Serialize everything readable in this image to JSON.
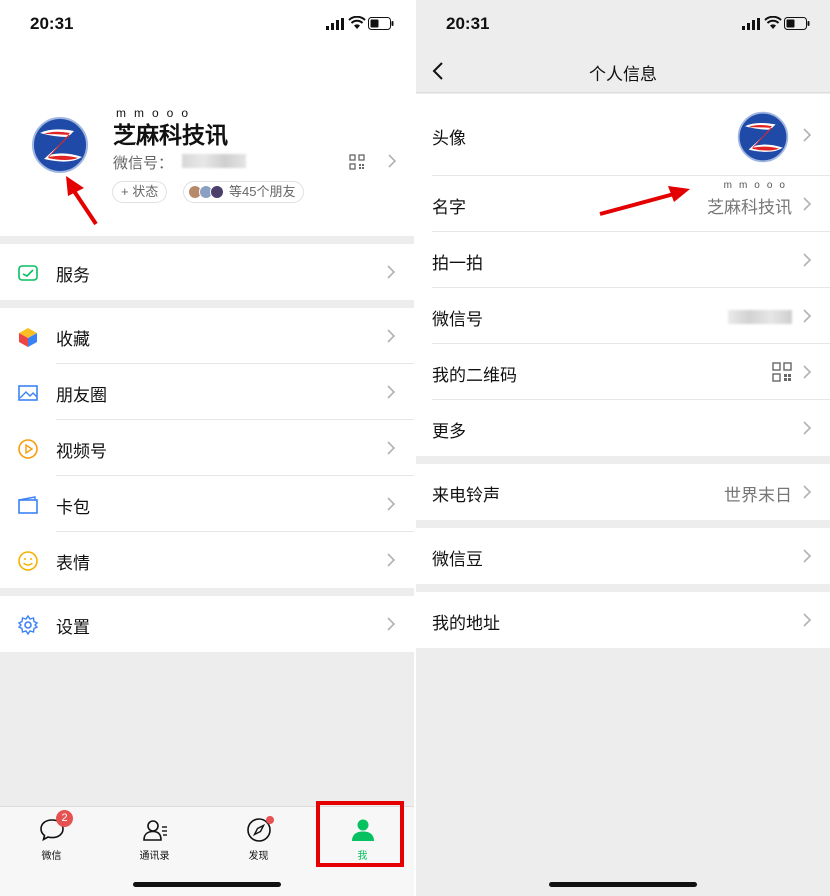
{
  "left": {
    "status_bar": {
      "time": "20:31"
    },
    "profile": {
      "nickname_dots": "mmooo",
      "nickname": "芝麻科技讯",
      "wechat_id_label": "微信号：",
      "status_button": "+ 状态",
      "friends_text": "等45个朋友"
    },
    "menu_groups": [
      [
        {
          "label": "服务",
          "icon": "pay-icon"
        }
      ],
      [
        {
          "label": "收藏",
          "icon": "favorites-cube-icon"
        },
        {
          "label": "朋友圈",
          "icon": "moments-image-icon"
        },
        {
          "label": "视频号",
          "icon": "channels-play-icon"
        },
        {
          "label": "卡包",
          "icon": "card-wallet-icon"
        },
        {
          "label": "表情",
          "icon": "emoji-smile-icon"
        }
      ],
      [
        {
          "label": "设置",
          "icon": "gear-icon"
        }
      ]
    ],
    "tabs": [
      {
        "label": "微信",
        "badge": "2"
      },
      {
        "label": "通讯录"
      },
      {
        "label": "发现"
      },
      {
        "label": "我"
      }
    ]
  },
  "right": {
    "status_bar": {
      "time": "20:31"
    },
    "title": "个人信息",
    "groups": [
      [
        {
          "label": "头像"
        },
        {
          "label": "名字",
          "value_dots": "mmooo",
          "value": "芝麻科技讯"
        },
        {
          "label": "拍一拍"
        },
        {
          "label": "微信号"
        },
        {
          "label": "我的二维码"
        },
        {
          "label": "更多"
        }
      ],
      [
        {
          "label": "来电铃声",
          "value": "世界末日"
        }
      ],
      [
        {
          "label": "微信豆"
        }
      ],
      [
        {
          "label": "我的地址"
        }
      ]
    ]
  },
  "colors": {
    "accent_green": "#07c160",
    "annotation_red": "#e40000",
    "badge_red": "#e65151"
  }
}
